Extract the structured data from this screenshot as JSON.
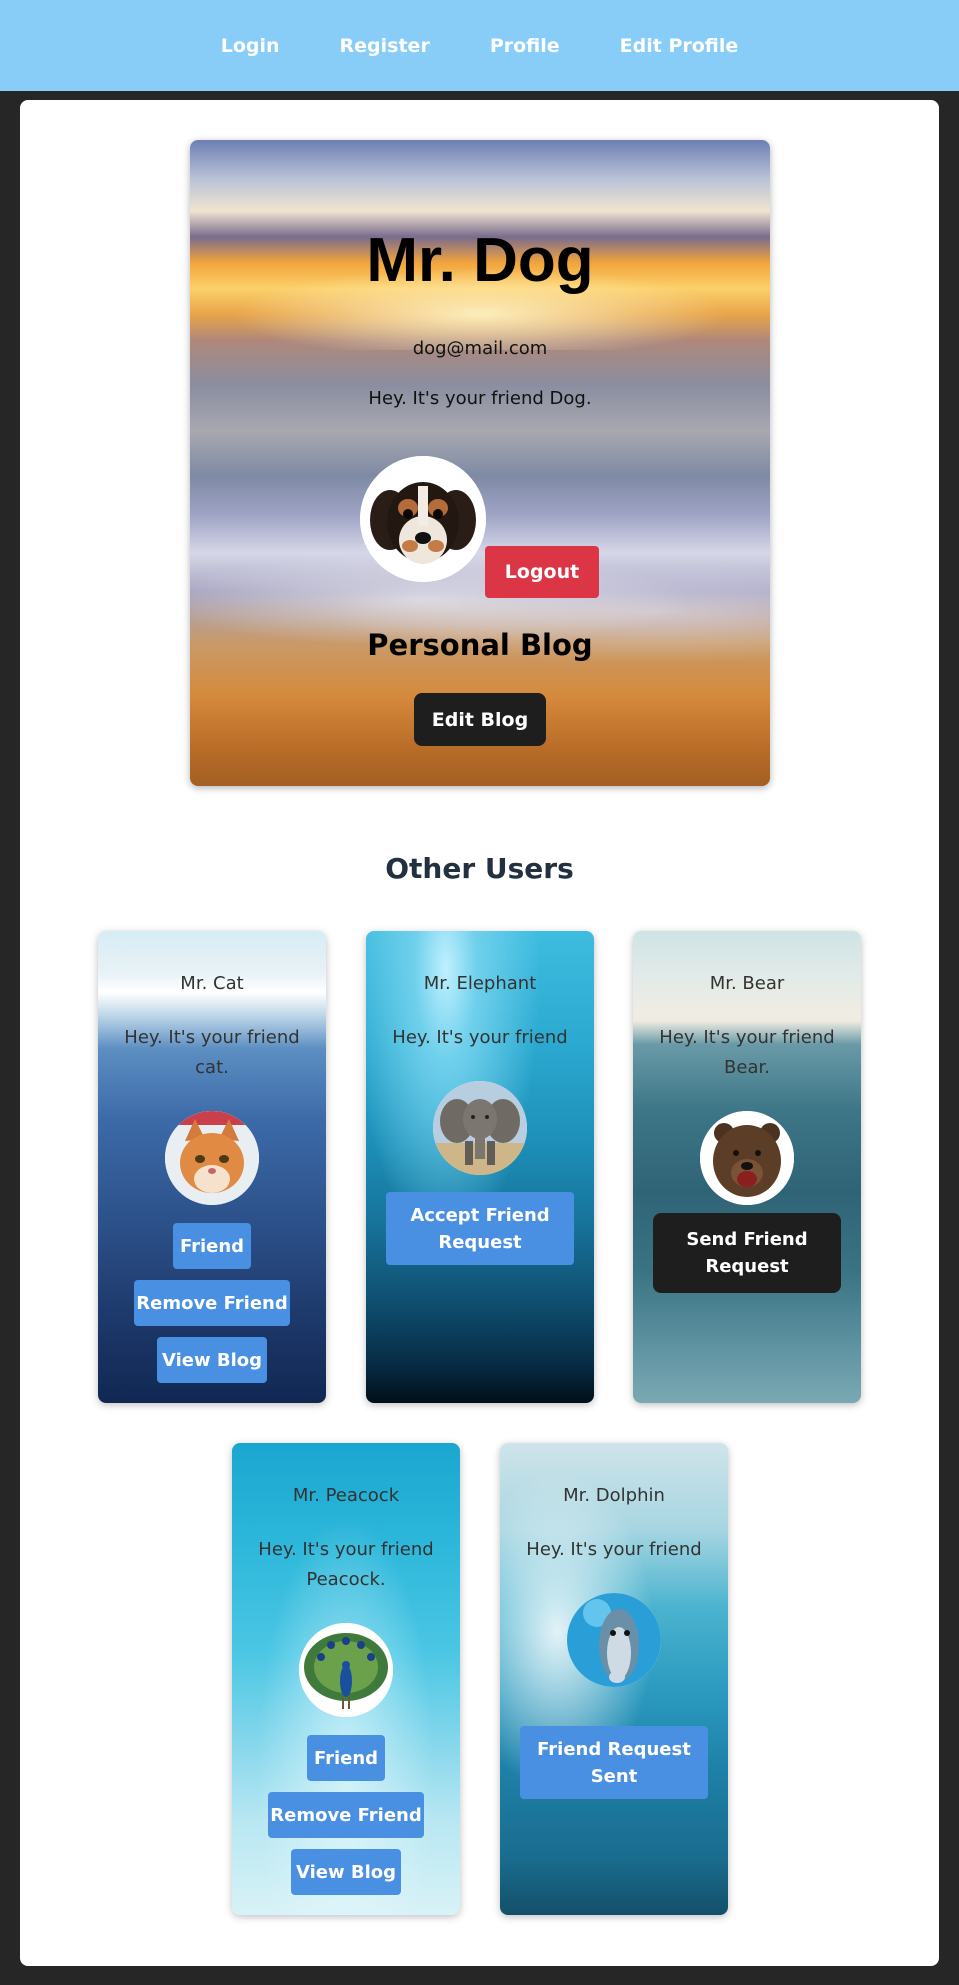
{
  "nav": {
    "items": [
      {
        "label": "Login"
      },
      {
        "label": "Register"
      },
      {
        "label": "Profile"
      },
      {
        "label": "Edit Profile"
      }
    ]
  },
  "profile": {
    "name": "Mr. Dog",
    "email": "dog@mail.com",
    "bio": "Hey. It's your friend Dog.",
    "logout_label": "Logout",
    "blog_heading": "Personal Blog",
    "edit_blog_label": "Edit Blog"
  },
  "other_users": {
    "heading": "Other Users",
    "users": [
      {
        "name": "Mr. Cat",
        "bio": "Hey. It's your friend cat.",
        "buttons": [
          "Friend",
          "Remove Friend",
          "View Blog"
        ]
      },
      {
        "name": "Mr. Elephant",
        "bio": "Hey. It's your friend",
        "buttons": [
          "Accept Friend Request"
        ]
      },
      {
        "name": "Mr. Bear",
        "bio": "Hey. It's your friend Bear.",
        "buttons": [
          "Send Friend Request"
        ]
      },
      {
        "name": "Mr. Peacock",
        "bio": "Hey. It's your friend Peacock.",
        "buttons": [
          "Friend",
          "Remove Friend",
          "View Blog"
        ]
      },
      {
        "name": "Mr. Dolphin",
        "bio": "Hey. It's your friend",
        "buttons": [
          "Friend Request Sent"
        ]
      }
    ]
  },
  "colors": {
    "navbar": "#87cdf8",
    "logout": "#dc3545",
    "primary_button": "#4a90e2",
    "dark_button": "#1e1e1e",
    "page_background": "#262626"
  }
}
